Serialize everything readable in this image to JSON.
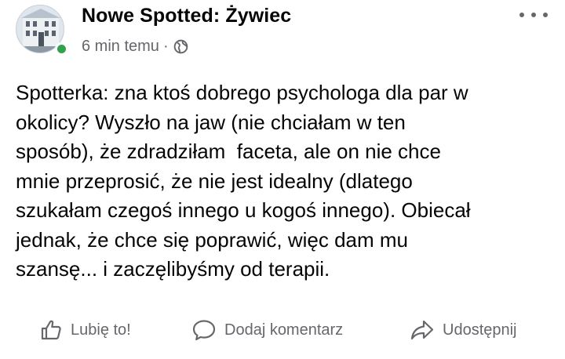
{
  "post": {
    "page_name": "Nowe Spotted: Żywiec",
    "time": "6 min temu",
    "separator": "·",
    "privacy_icon": "globe-icon",
    "more_icon": "more-horizontal-icon",
    "text": "Spotterka: zna ktoś dobrego psychologa dla par w\nokolicy? Wyszło na jaw (nie chciałam w ten\nsposób), że zdradziłam  faceta, ale on nie chce\nmnie przeprosić, że nie jest idealny (dlatego\nszukałam czegoś innego u kogoś innego). Obiecał\njednak, że chce się poprawić, więc dam mu\nszansę... i zaczęlibyśmy od terapii."
  },
  "actions": {
    "like_label": "Lubię to!",
    "comment_label": "Dodaj komentarz",
    "share_label": "Udostępnij",
    "like_icon": "thumbs-up-icon",
    "comment_icon": "speech-bubble-icon",
    "share_icon": "share-arrow-icon"
  },
  "colors": {
    "text_primary": "#050505",
    "text_secondary": "#65676b",
    "online_status": "#31a24c",
    "background": "#ffffff"
  }
}
